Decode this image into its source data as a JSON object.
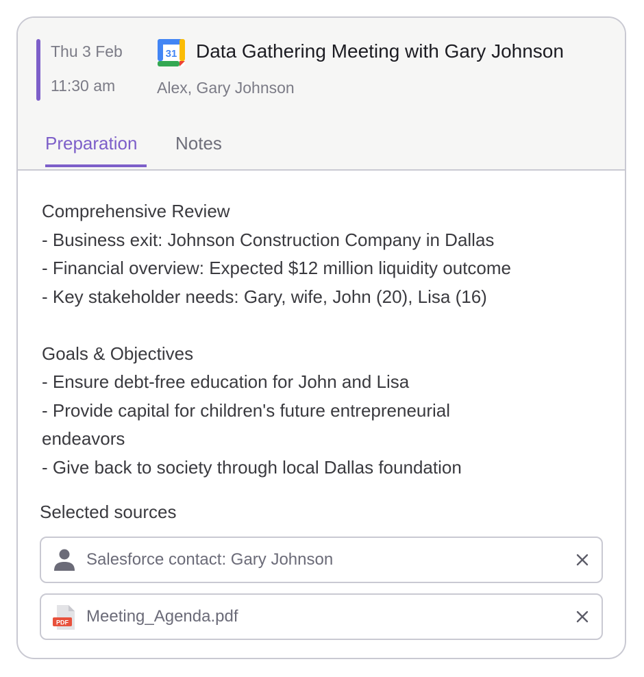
{
  "event": {
    "date": "Thu 3 Feb",
    "time": "11:30 am",
    "title": "Data Gathering Meeting with Gary Johnson",
    "attendees": "Alex, Gary Johnson",
    "calendar_icon_text": "31",
    "accent_color": "#7d5fc9"
  },
  "tabs": [
    {
      "label": "Preparation",
      "active": true
    },
    {
      "label": "Notes",
      "active": false
    }
  ],
  "preparation": {
    "sections": [
      {
        "heading": "Comprehensive Review",
        "items": [
          "- Business exit: Johnson Construction Company in Dallas",
          "- Financial overview: Expected $12 million liquidity outcome",
          "- Key stakeholder needs: Gary, wife, John (20), Lisa (16)"
        ]
      },
      {
        "heading": "Goals & Objectives",
        "items": [
          "- Ensure debt-free education for John and Lisa",
          "- Provide capital for children's future entrepreneurial",
          "endeavors",
          "- Give back to society through local Dallas foundation"
        ]
      }
    ]
  },
  "sources": {
    "label": "Selected sources",
    "items": [
      {
        "icon": "person-icon",
        "label": "Salesforce contact: Gary Johnson"
      },
      {
        "icon": "pdf-file-icon",
        "label": "Meeting_Agenda.pdf",
        "icon_text": "PDF"
      }
    ]
  }
}
